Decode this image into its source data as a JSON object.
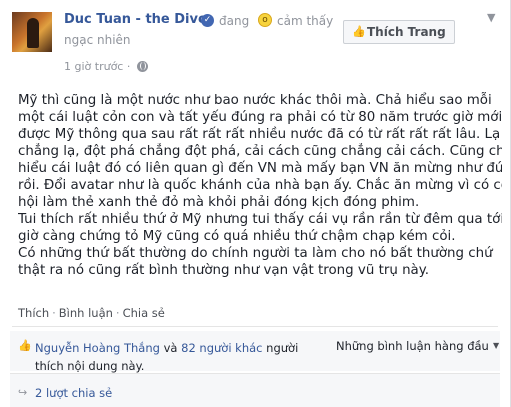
{
  "post": {
    "author": "Duc Tuan - the Divo",
    "feeling_prefix": "đang",
    "feeling_verb": "cảm thấy",
    "feeling": "ngạc nhiên",
    "time": "1 giờ trước ·",
    "like_page_label": "Thích Trang",
    "body_lines": [
      "Mỹ thì cũng là một nước như bao nước khác thôi mà. Chả hiểu sao mỗi",
      "một cái luật cỏn con và tất yếu đúng ra phải có từ 80 năm trước giờ mới",
      "được Mỹ thông qua sau rất rất rất nhiều nước đã có từ rất rất rất lâu. Lạ",
      "chẳng lạ, đột phá chẳng đột phá, cải cách cũng chẳng cải cách. Cũng chả",
      "hiểu cái luật đó có liên quan gì đến VN mà mấy bạn VN ăn mừng như đúng",
      "rồi. Đổi avatar như là quốc khánh của nhà bạn ấy. Chắc ăn mừng vì có cơ",
      "hội làm thẻ xanh thẻ đỏ mà khỏi phải đóng kịch đóng phim.",
      "Tui thích rất nhiều thứ ở Mỹ nhưng tui thấy cái vụ rần rần từ đêm qua tới",
      "giờ càng chứng tỏ Mỹ cũng có quá nhiều thứ chậm chạp kém cỏi.",
      "Có những thứ bất thường do chính người ta làm cho nó bất thường chứ",
      "thật ra nó cũng rất bình thường như vạn vật trong vũ trụ này."
    ]
  },
  "actions": {
    "like": "Thích",
    "comment": "Bình luận",
    "share": "Chia sẻ",
    "separator": "·"
  },
  "likes": {
    "person": "Nguyễn Hoàng Thắng",
    "and": "và",
    "others": "82 người khác",
    "suffix": "người thích nội dung này."
  },
  "sort": {
    "label": "Những bình luận hàng đầu"
  },
  "shares": {
    "label": "2 lượt chia sẻ"
  },
  "icons": {
    "verified": "verified-badge-icon",
    "emoji": "surprised-emoji-icon",
    "globe": "public-globe-icon",
    "like": "thumbs-up-icon",
    "share": "share-icon",
    "chevron": "chevron-down-icon"
  },
  "colors": {
    "link": "#365899",
    "meta": "#90949c",
    "text": "#1d2129",
    "accent": "#4267b2"
  }
}
